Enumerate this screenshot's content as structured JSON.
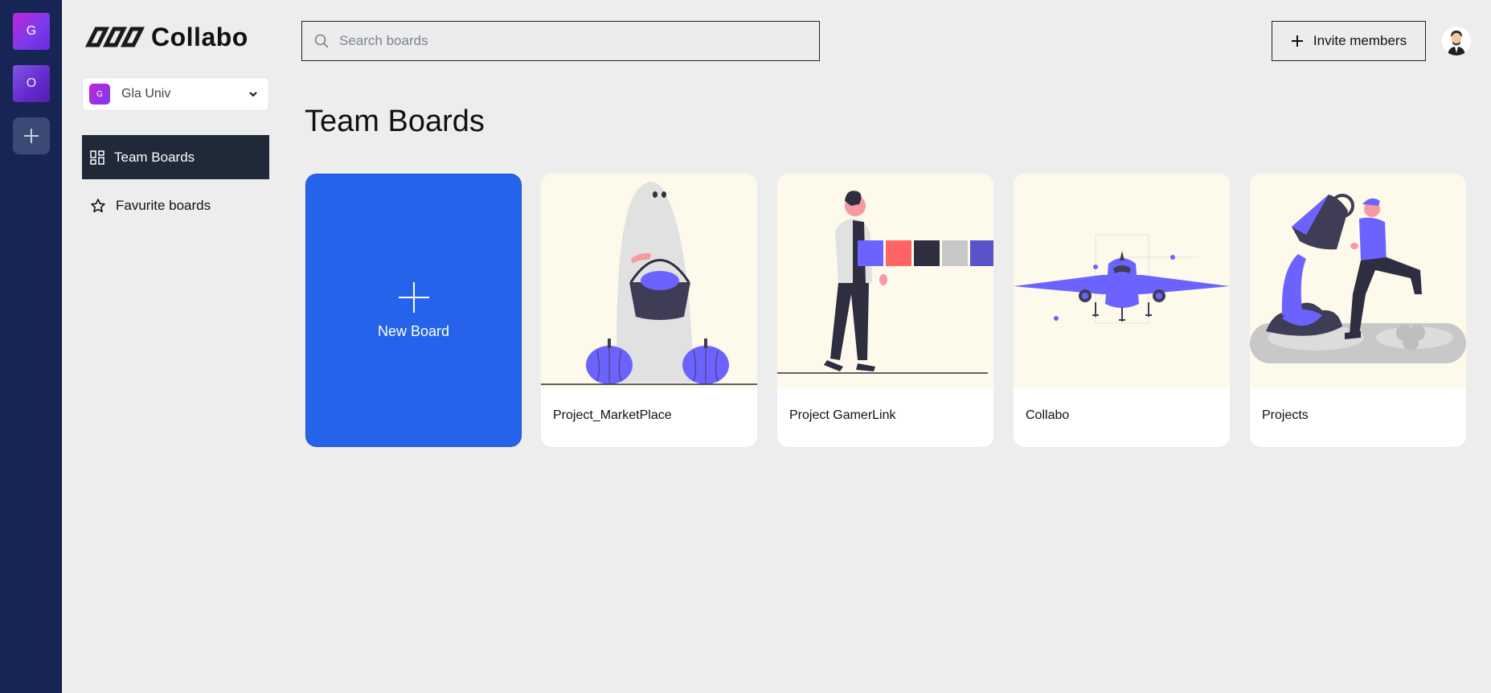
{
  "orgs": [
    {
      "initial": "G"
    },
    {
      "initial": "O"
    }
  ],
  "app": {
    "name": "Collabo"
  },
  "org_selector": {
    "initial": "G",
    "name": "Gla Univ"
  },
  "nav": {
    "team_boards": "Team Boards",
    "favorite_boards": "Favurite boards"
  },
  "search": {
    "placeholder": "Search boards",
    "value": ""
  },
  "header": {
    "invite_label": "Invite members"
  },
  "page": {
    "title": "Team Boards"
  },
  "new_board": {
    "label": "New Board"
  },
  "boards": [
    {
      "name": "Project_MarketPlace",
      "image": "ghost-with-pumpkins"
    },
    {
      "name": "Project GamerLink",
      "image": "person-with-color-palette"
    },
    {
      "name": "Collabo",
      "image": "airplane"
    },
    {
      "name": "Projects",
      "image": "person-pouring-paint"
    }
  ],
  "colors": {
    "rail_bg": "#172554",
    "accent_blue": "#2563eb",
    "active_nav_bg": "#1f2937",
    "illustration_purple": "#6c63ff",
    "card_thumb_bg": "#fdfaeb"
  }
}
